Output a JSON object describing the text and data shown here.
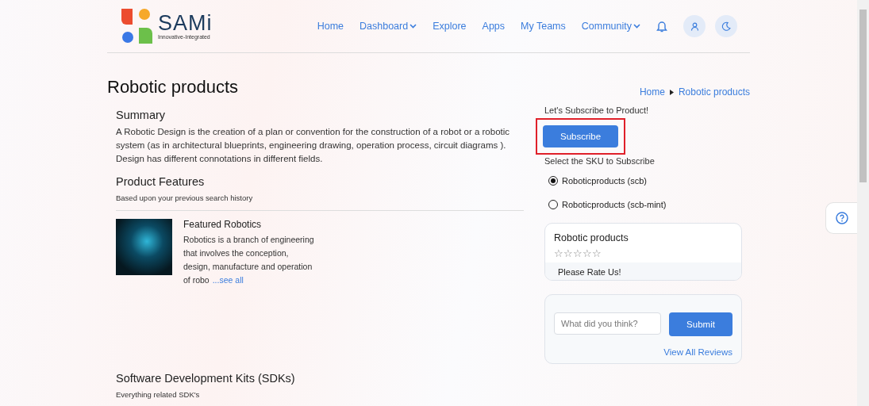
{
  "brand": {
    "name": "SAMi",
    "tagline": "Innovative-Integrated"
  },
  "nav": [
    {
      "label": "Home",
      "dropdown": false
    },
    {
      "label": "Dashboard",
      "dropdown": true
    },
    {
      "label": "Explore",
      "dropdown": false
    },
    {
      "label": "Apps",
      "dropdown": false
    },
    {
      "label": "My Teams",
      "dropdown": false
    },
    {
      "label": "Community",
      "dropdown": true
    }
  ],
  "page_title": "Robotic products",
  "breadcrumb": [
    "Home",
    "Robotic products"
  ],
  "summary": {
    "heading": "Summary",
    "text": "A Robotic Design is the creation of a plan or convention for the construction of a robot or a robotic system (as in architectural blueprints, engineering drawing, operation process, circuit diagrams ). Design has different connotations in different fields."
  },
  "features": {
    "heading": "Product Features",
    "subtitle": "Based upon your previous search history",
    "item": {
      "title": "Featured Robotics",
      "text": "Robotics is a branch of engineering that involves the conception, design, manufacture and operation of robo",
      "link": "...see all"
    }
  },
  "sdks": {
    "heading": "Software Development Kits (SDKs)",
    "subtitle": "Everything related SDK's"
  },
  "subscribe": {
    "prompt": "Let's Subscribe to Product!",
    "button": "Subscribe",
    "highlighted": true,
    "sku_label": "Select the SKU to Subscribe",
    "skus": [
      {
        "label": "Roboticproducts (scb)",
        "selected": true
      },
      {
        "label": "Roboticproducts (scb-mint)",
        "selected": false
      }
    ]
  },
  "rating": {
    "title": "Robotic products",
    "stars": 0,
    "prompt": "Please Rate Us!"
  },
  "review": {
    "placeholder": "What did you think?",
    "button": "Submit",
    "link": "View All Reviews"
  }
}
